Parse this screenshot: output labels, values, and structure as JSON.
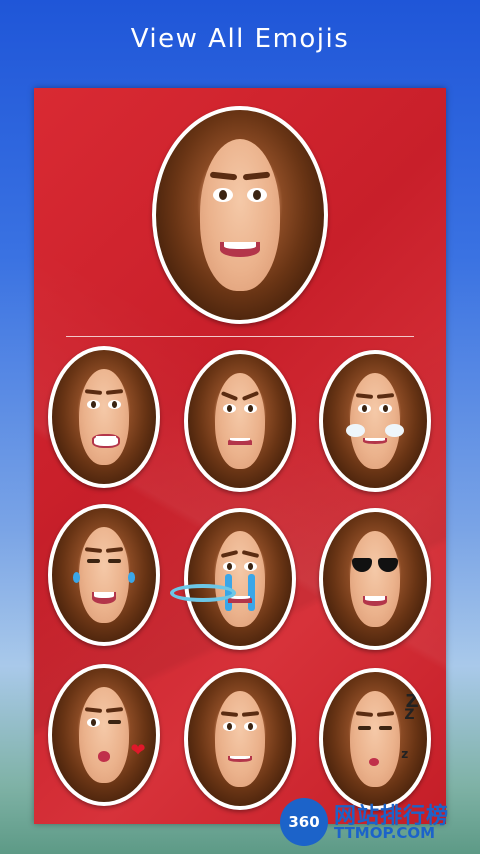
{
  "header": {
    "title": "View All Emojis"
  },
  "preview": {
    "emoji_name": "smile-face-emoji"
  },
  "grid": {
    "items": [
      {
        "name": "grimace-face-emoji"
      },
      {
        "name": "angry-face-emoji"
      },
      {
        "name": "steam-nose-face-emoji"
      },
      {
        "name": "laugh-tears-face-emoji"
      },
      {
        "name": "crying-face-emoji"
      },
      {
        "name": "sunglasses-face-emoji"
      },
      {
        "name": "kiss-wink-face-emoji"
      },
      {
        "name": "angel-halo-face-emoji"
      },
      {
        "name": "sleeping-face-emoji"
      }
    ]
  },
  "watermark": {
    "logo": "360",
    "text": "网站排行榜",
    "sub": "TTMOP.COM"
  },
  "colors": {
    "panel": "#d22630",
    "background_top": "#1f56d8",
    "background_bottom": "#5d9a86"
  }
}
